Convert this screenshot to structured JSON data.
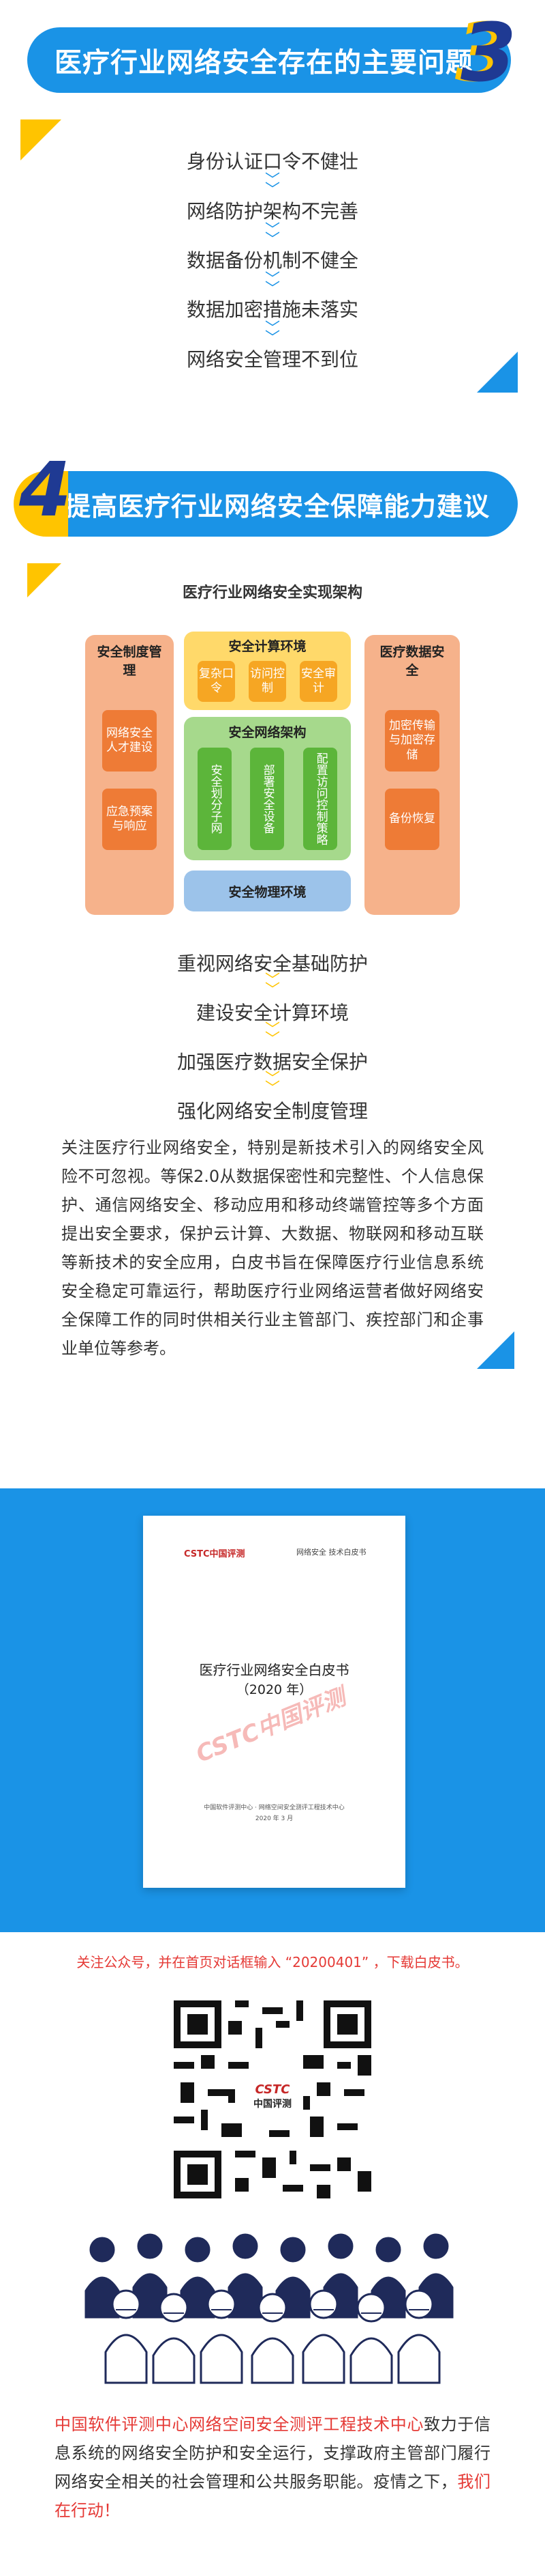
{
  "section3": {
    "title": "医疗行业网络安全存在的主要问题",
    "number": "3",
    "issues": [
      "身份认证口令不健壮",
      "网络防护架构不完善",
      "数据备份机制不健全",
      "数据加密措施未落实",
      "网络安全管理不到位"
    ]
  },
  "section4": {
    "number": "4",
    "title": "提高医疗行业网络安全保障能力建议",
    "arch": {
      "title": "医疗行业网络安全实现架构",
      "left": {
        "title": "安全制度管理",
        "cells": [
          "网络安全人才建设",
          "应急预案与响应"
        ]
      },
      "calc": {
        "title": "安全计算环境",
        "cells": [
          "复杂口令",
          "访问控制",
          "安全审计"
        ]
      },
      "net": {
        "title": "安全网络架构",
        "cells": [
          "安全划分子网",
          "部署安全设备",
          "配置访问控制策略"
        ]
      },
      "phys": {
        "title": "安全物理环境"
      },
      "right": {
        "title": "医疗数据安全",
        "cells": [
          "加密传输与加密存储",
          "备份恢复"
        ]
      }
    },
    "steps": [
      "重视网络安全基础防护",
      "建设安全计算环境",
      "加强医疗数据安全保护",
      "强化网络安全制度管理"
    ],
    "paragraph": "关注医疗行业网络安全，特别是新技术引入的网络安全风险不可忽视。等保2.0从数据保密性和完整性、个人信息保护、通信网络安全、移动应用和移动终端管控等多个方面提出安全要求，保护云计算、大数据、物联网和移动互联等新技术的安全应用，白皮书旨在保障医疗行业信息系统安全稳定可靠运行，帮助医疗行业网络运营者做好网络安全保障工作的同时供相关行业主管部门、疾控部门和企事业单位等参考。"
  },
  "whitepaper": {
    "logo_left": "CSTC中国评测",
    "logo_right": "网络安全 技术白皮书",
    "title_line1": "医疗行业网络安全白皮书",
    "title_line2": "（2020 年）",
    "watermark": "CSTC中国评测",
    "footer_line1": "中国软件评测中心 · 网络空间安全测评工程技术中心",
    "footer_line2": "2020 年 3 月"
  },
  "cta": {
    "text": "关注公众号，并在首页对话框输入 “20200401” ，下载白皮书。",
    "qr_logo_top": "CSTC",
    "qr_logo_bottom": "中国评测"
  },
  "footer": {
    "org": "中国软件评测中心网络空间安全测评工程技术中心",
    "body": "致力于信息系统的网络安全防护和安全运行，支撑政府主管部门履行网络安全相关的社会管理和公共服务职能。疫情之下，",
    "action": "我们在行动！"
  },
  "colors": {
    "blue": "#1a93e6",
    "yellow": "#ffc400",
    "orange": "#f28c4e",
    "green": "#6cc04a",
    "red": "#e53935"
  }
}
